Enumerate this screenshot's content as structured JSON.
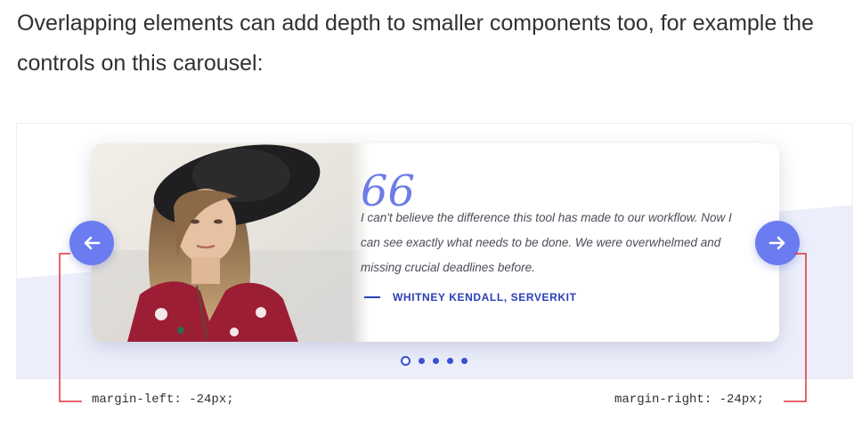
{
  "intro": {
    "text": "Overlapping elements can add depth to smaller components too, for example the controls on this carousel:"
  },
  "carousel": {
    "quote_mark": "66",
    "quote": "I can't believe the difference this tool has made to our workflow. Now I can see exactly what needs to be done. We were overwhelmed and missing crucial deadlines before.",
    "author": "WHITNEY KENDALL, SERVERKIT",
    "prev_icon": "arrow-left-icon",
    "next_icon": "arrow-right-icon",
    "dots": {
      "count": 5,
      "active_index": 0
    }
  },
  "annotations": {
    "left": "margin-left: -24px;",
    "right": "margin-right: -24px;"
  },
  "colors": {
    "accent": "#6a7cf0",
    "author": "#2c3fb6",
    "stage_band": "#eceffb",
    "annotation_line": "#e0313b"
  }
}
